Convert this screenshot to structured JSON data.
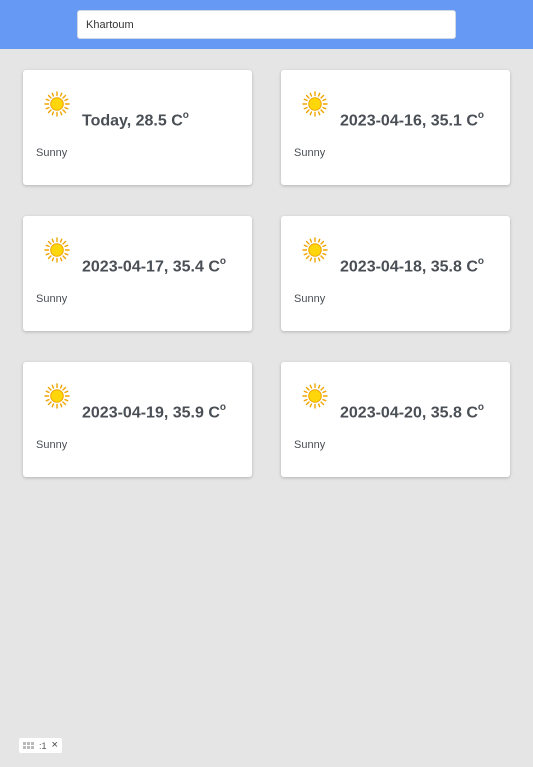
{
  "search": {
    "value": "Khartoum"
  },
  "forecast": [
    {
      "label": "Today, 28.5 C",
      "unit_sup": "o",
      "condition": "Sunny",
      "icon": "sun-icon"
    },
    {
      "label": "2023-04-16, 35.1 C",
      "unit_sup": "o",
      "condition": "Sunny",
      "icon": "sun-icon"
    },
    {
      "label": "2023-04-17, 35.4 C",
      "unit_sup": "o",
      "condition": "Sunny",
      "icon": "sun-icon"
    },
    {
      "label": "2023-04-18, 35.8 C",
      "unit_sup": "o",
      "condition": "Sunny",
      "icon": "sun-icon"
    },
    {
      "label": "2023-04-19, 35.9 C",
      "unit_sup": "o",
      "condition": "Sunny",
      "icon": "sun-icon"
    },
    {
      "label": "2023-04-20, 35.8 C",
      "unit_sup": "o",
      "condition": "Sunny",
      "icon": "sun-icon"
    }
  ],
  "devtools_badge": {
    "text": ":1",
    "close": "×"
  },
  "colors": {
    "header": "#6699f3",
    "background": "#e5e5e5",
    "card": "#ffffff",
    "text": "#4a4f56",
    "sun_core": "#ffd60a",
    "sun_rays": "#f0a400"
  }
}
